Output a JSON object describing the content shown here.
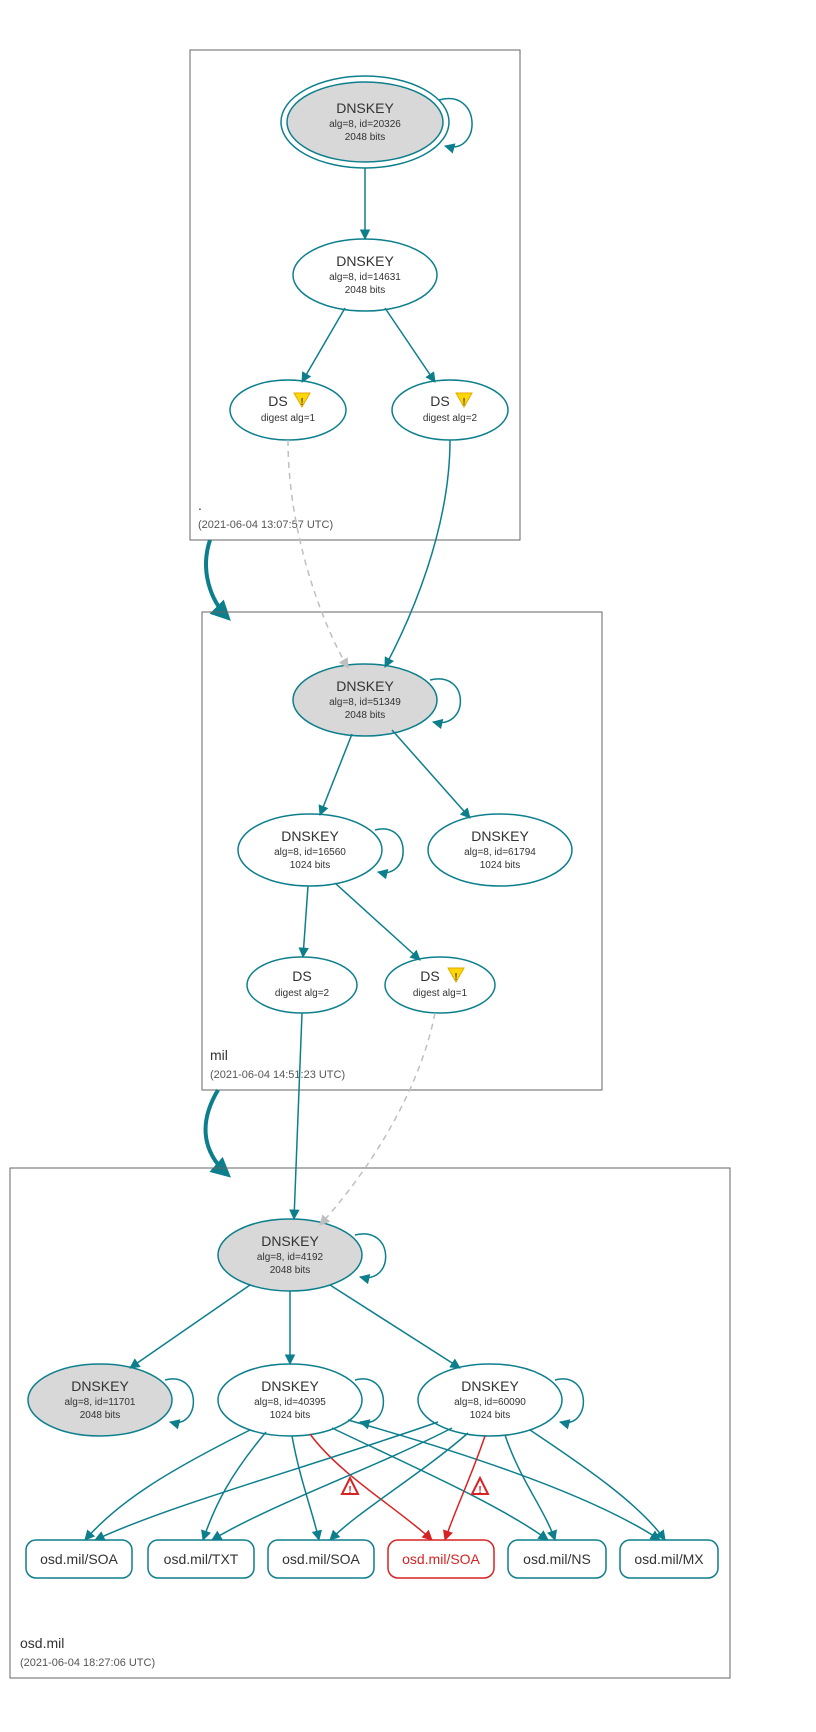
{
  "zones": {
    "root": {
      "label": ".",
      "timestamp": "(2021-06-04 13:07:57 UTC)"
    },
    "mil": {
      "label": "mil",
      "timestamp": "(2021-06-04 14:51:23 UTC)"
    },
    "osd": {
      "label": "osd.mil",
      "timestamp": "(2021-06-04 18:27:06 UTC)"
    }
  },
  "nodes": {
    "root_ksk": {
      "title": "DNSKEY",
      "sub1": "alg=8, id=20326",
      "sub2": "2048 bits"
    },
    "root_zsk": {
      "title": "DNSKEY",
      "sub1": "alg=8, id=14631",
      "sub2": "2048 bits"
    },
    "root_ds1": {
      "title": "DS",
      "sub1": "digest alg=1",
      "warn": true
    },
    "root_ds2": {
      "title": "DS",
      "sub1": "digest alg=2",
      "warn": true
    },
    "mil_ksk": {
      "title": "DNSKEY",
      "sub1": "alg=8, id=51349",
      "sub2": "2048 bits"
    },
    "mil_zsk1": {
      "title": "DNSKEY",
      "sub1": "alg=8, id=16560",
      "sub2": "1024 bits"
    },
    "mil_zsk2": {
      "title": "DNSKEY",
      "sub1": "alg=8, id=61794",
      "sub2": "1024 bits"
    },
    "mil_ds1": {
      "title": "DS",
      "sub1": "digest alg=2"
    },
    "mil_ds2": {
      "title": "DS",
      "sub1": "digest alg=1",
      "warn": true
    },
    "osd_ksk": {
      "title": "DNSKEY",
      "sub1": "alg=8, id=4192",
      "sub2": "2048 bits"
    },
    "osd_key1": {
      "title": "DNSKEY",
      "sub1": "alg=8, id=11701",
      "sub2": "2048 bits"
    },
    "osd_key2": {
      "title": "DNSKEY",
      "sub1": "alg=8, id=40395",
      "sub2": "1024 bits"
    },
    "osd_key3": {
      "title": "DNSKEY",
      "sub1": "alg=8, id=60090",
      "sub2": "1024 bits"
    }
  },
  "records": {
    "r1": "osd.mil/SOA",
    "r2": "osd.mil/TXT",
    "r3": "osd.mil/SOA",
    "r4": "osd.mil/SOA",
    "r5": "osd.mil/NS",
    "r6": "osd.mil/MX"
  }
}
